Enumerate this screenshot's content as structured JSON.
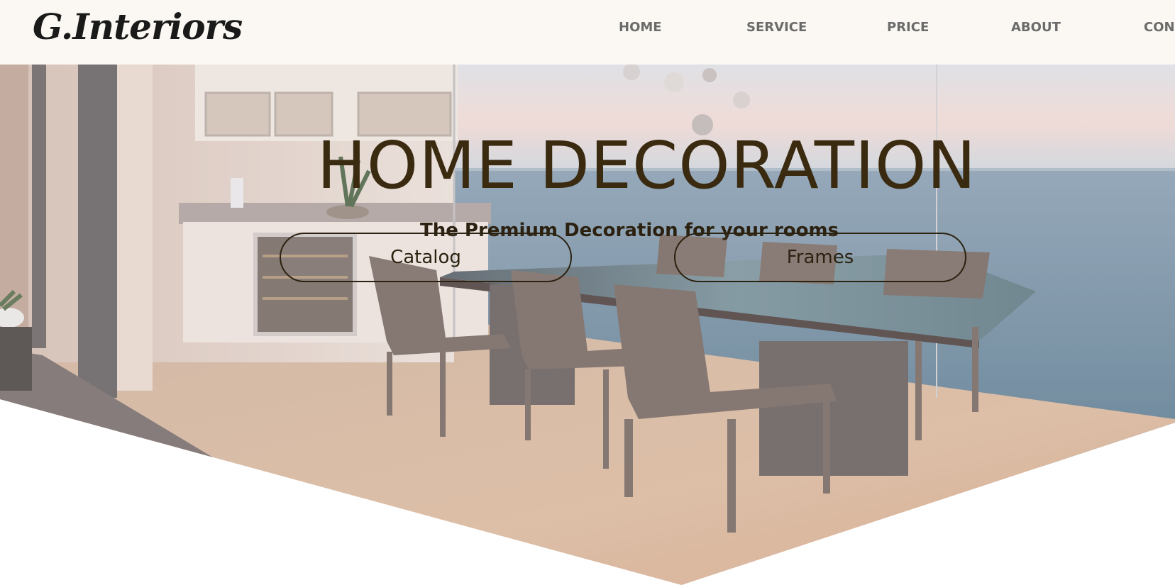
{
  "header": {
    "logo": "G.Interiors",
    "nav": {
      "home": "HOME",
      "service": "SERVICE",
      "price": "PRICE",
      "about": "ABOUT",
      "contact": "CON"
    }
  },
  "hero": {
    "title": "HOME DECORATION",
    "subtitle": "The Premium Decoration for your rooms",
    "buttons": {
      "catalog": "Catalog",
      "frames": "Frames"
    }
  },
  "colors": {
    "header_bg": "#fbf8f3",
    "title_text": "#3a2a10",
    "nav_text": "#6b6b6b"
  }
}
